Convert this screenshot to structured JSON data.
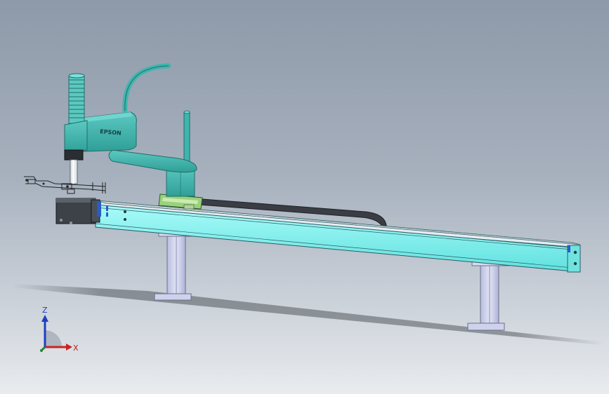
{
  "viewport": {
    "background_top": "#8e99a9",
    "background_bottom": "#e9ecef"
  },
  "model": {
    "robot_brand": "EPSON",
    "colors": {
      "robot": "#3fb5ad",
      "robot_dark": "#1f6e69",
      "rail": "#7ff1ef",
      "rail_edge": "#2b5d66",
      "legs": "#c9cde6",
      "motor": "#3c4247",
      "carriage": "#9ad17a",
      "cable": "#3a3e44"
    }
  },
  "triad": {
    "x_label": "X",
    "z_label": "Z",
    "x_color": "#cc2222",
    "z_color": "#1f3fbf",
    "y_color": "#1e8a2e"
  }
}
